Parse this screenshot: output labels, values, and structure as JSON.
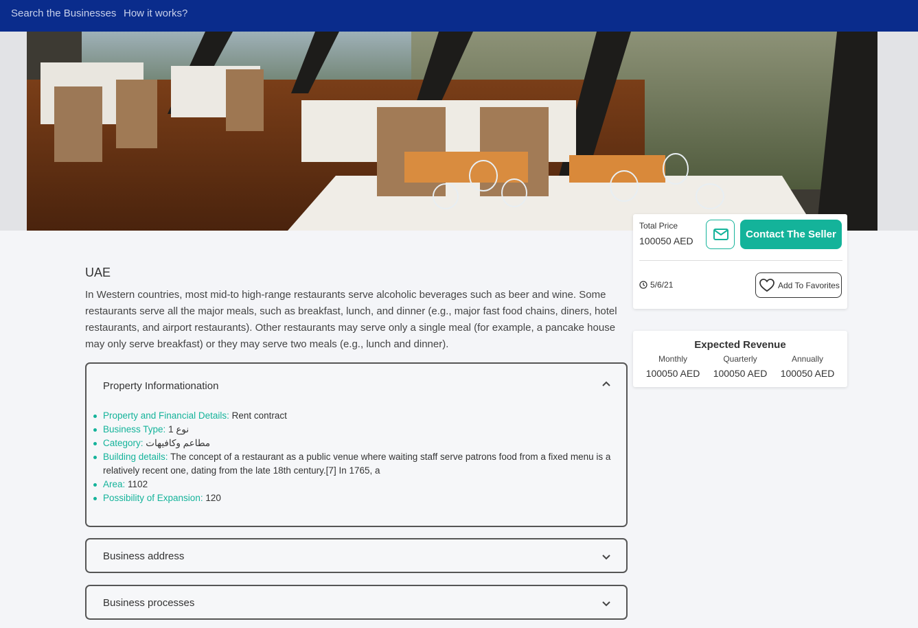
{
  "nav": {
    "search_link": "Search the Businesses",
    "how_link": "How it works?"
  },
  "listing": {
    "country": "UAE",
    "description": "In Western countries, most mid-to high-range restaurants serve alcoholic beverages such as beer and wine. Some restaurants serve all the major meals, such as breakfast, lunch, and dinner (e.g., major fast food chains, diners, hotel restaurants, and airport restaurants). Other restaurants may serve only a single meal (for example, a pancake house may only serve breakfast) or they may serve two meals (e.g., lunch and dinner)."
  },
  "property_info": {
    "title": "Property Informationation",
    "items": [
      {
        "key": "Property and Financial Details:",
        "value": "Rent contract"
      },
      {
        "key": "Business Type:",
        "value": "نوع 1"
      },
      {
        "key": "Category:",
        "value": "مطاعم وكافيهات"
      },
      {
        "key": "Building details:",
        "value": "The concept of a restaurant as a public venue where waiting staff serve patrons food from a fixed menu is a relatively recent one, dating from the late 18th century.[7] In 1765, a"
      },
      {
        "key": "Area:",
        "value": "1102"
      },
      {
        "key": "Possibility of Expansion:",
        "value": "120"
      }
    ]
  },
  "sections": {
    "business_address": "Business address",
    "business_processes": "Business processes"
  },
  "price_card": {
    "label": "Total Price",
    "value": "100050  AED",
    "contact_label": "Contact The Seller",
    "date": "5/6/21",
    "favorites_label": "Add To Favorites"
  },
  "revenue": {
    "title": "Expected Revenue",
    "monthly_label": "Monthly",
    "monthly_value": "100050  AED",
    "quarterly_label": "Quarterly",
    "quarterly_value": "100050  AED",
    "annually_label": "Annually",
    "annually_value": "100050  AED"
  },
  "colors": {
    "nav_bg": "#0a2c8c",
    "accent": "#14b39a",
    "page_bg": "#f4f5f8"
  },
  "icons": {
    "mail": "mail-icon",
    "clock": "clock-icon",
    "heart": "heart-icon",
    "chevron_up": "chevron-up-icon",
    "chevron_down": "chevron-down-icon"
  }
}
